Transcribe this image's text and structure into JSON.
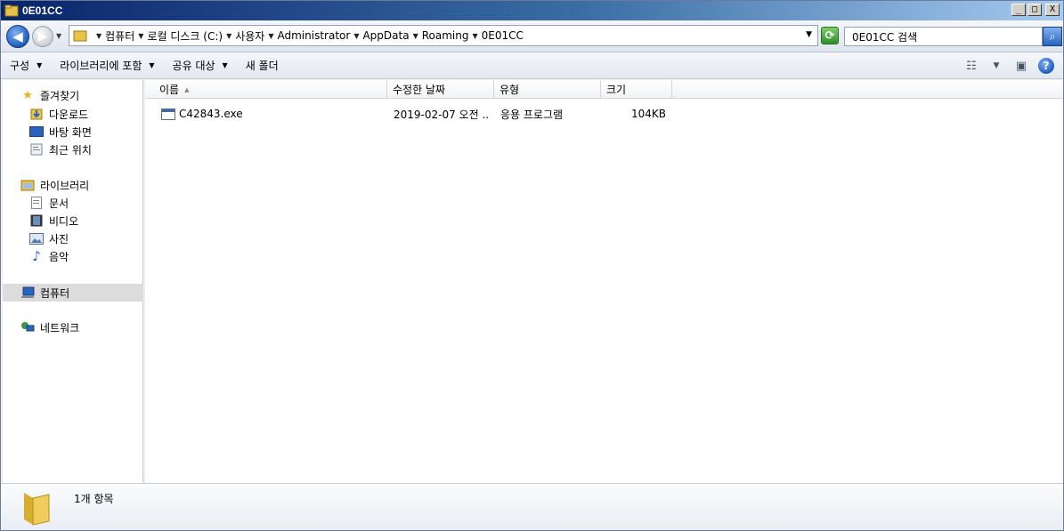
{
  "window": {
    "title": "0E01CC",
    "minimize_glyph": "_",
    "maximize_glyph": "□",
    "close_glyph": "X"
  },
  "address": {
    "crumbs": [
      "컴퓨터",
      "로컬 디스크 (C:)",
      "사용자",
      "Administrator",
      "AppData",
      "Roaming",
      "0E01CC"
    ],
    "search_placeholder": "0E01CC 검색"
  },
  "toolbar": {
    "organize": "구성",
    "include_library": "라이브러리에 포함",
    "share_with": "공유 대상",
    "new_folder": "새 폴더"
  },
  "nav": {
    "favorites": {
      "label": "즐겨찾기",
      "items": [
        "다운로드",
        "바탕 화면",
        "최근 위치"
      ]
    },
    "libraries": {
      "label": "라이브러리",
      "items": [
        "문서",
        "비디오",
        "사진",
        "음악"
      ]
    },
    "computer": "컴퓨터",
    "network": "네트워크"
  },
  "columns": {
    "name": "이름",
    "modified": "수정한 날짜",
    "type": "유형",
    "size": "크기"
  },
  "files": [
    {
      "name": "C42843.exe",
      "modified": "2019-02-07 오전 ...",
      "type": "응용 프로그램",
      "size": "104KB"
    }
  ],
  "status": {
    "item_count": "1개 항목"
  },
  "colors": {
    "title_start": "#0a246a",
    "title_end": "#a6caf0",
    "nav_selected": "#dcdcdc"
  }
}
